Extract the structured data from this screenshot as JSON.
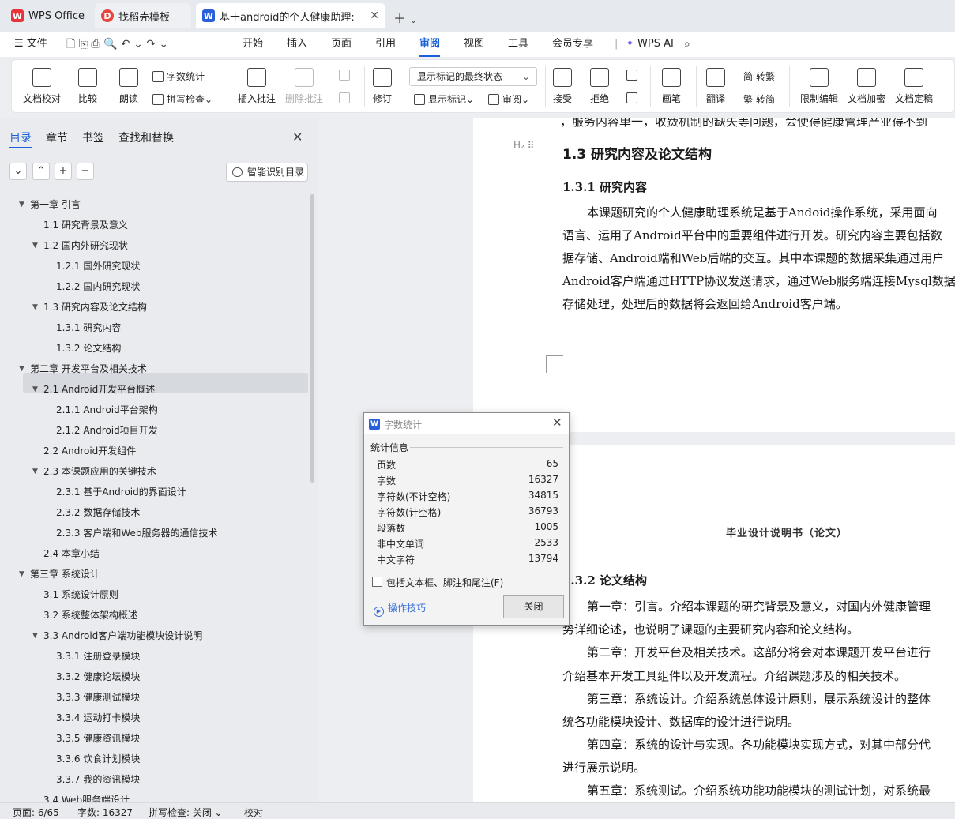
{
  "tabs": [
    {
      "label": "WPS Office",
      "icon": "wps-logo-icon"
    },
    {
      "label": "找稻壳模板",
      "icon": "docer-icon"
    },
    {
      "label": "基于android的个人健康助理:",
      "icon": "word-doc-icon"
    }
  ],
  "menu": {
    "file": "文件",
    "items": [
      "开始",
      "插入",
      "页面",
      "引用",
      "审阅",
      "视图",
      "工具",
      "会员专享"
    ],
    "active": "审阅",
    "ai": "WPS AI"
  },
  "ribbon": {
    "doc_check": "文档校对",
    "compare": "比较",
    "read_aloud": "朗读",
    "word_count": "字数统计",
    "spell_check": "拼写检查",
    "insert_comment": "插入批注",
    "delete_comment": "删除批注",
    "revise": "修订",
    "show_mode": "显示标记的最终状态",
    "show_marks": "显示标记",
    "review_pane": "审阅",
    "accept": "接受",
    "reject": "拒绝",
    "draw": "画笔",
    "translate": "翻译",
    "to_traditional": "转繁",
    "to_simplified": "转简",
    "restrict_edit": "限制编辑",
    "encrypt": "文档加密",
    "finalize": "文档定稿",
    "glyph_simp": "简",
    "glyph_trad": "繁"
  },
  "side_panel": {
    "tabs": [
      "目录",
      "章节",
      "书签",
      "查找和替换"
    ],
    "active_tab": "目录",
    "smart_toc": "智能识别目录",
    "toc": [
      {
        "label": "第一章  引言",
        "level": 1,
        "expanded": true
      },
      {
        "label": "1.1  研究背景及意义",
        "level": 2
      },
      {
        "label": "1.2  国内外研究现状",
        "level": 2,
        "expanded": true
      },
      {
        "label": "1.2.1  国外研究现状",
        "level": 3
      },
      {
        "label": "1.2.2  国内研究现状",
        "level": 3
      },
      {
        "label": "1.3  研究内容及论文结构",
        "level": 2,
        "expanded": true,
        "selected": true
      },
      {
        "label": "1.3.1  研究内容",
        "level": 3
      },
      {
        "label": "1.3.2  论文结构",
        "level": 3
      },
      {
        "label": "第二章  开发平台及相关技术",
        "level": 1,
        "expanded": true
      },
      {
        "label": "2.1 Android开发平台概述",
        "level": 2,
        "expanded": true
      },
      {
        "label": "2.1.1 Android平台架构",
        "level": 3
      },
      {
        "label": "2.1.2 Android项目开发",
        "level": 3
      },
      {
        "label": "2.2 Android开发组件",
        "level": 2
      },
      {
        "label": "2.3  本课题应用的关键技术",
        "level": 2,
        "expanded": true
      },
      {
        "label": "2.3.1  基于Android的界面设计",
        "level": 3
      },
      {
        "label": "2.3.2  数据存储技术",
        "level": 3
      },
      {
        "label": "2.3.3  客户端和Web服务器的通信技术",
        "level": 3
      },
      {
        "label": "2.4  本章小结",
        "level": 2
      },
      {
        "label": "第三章  系统设计",
        "level": 1,
        "expanded": true
      },
      {
        "label": "3.1  系统设计原则",
        "level": 2
      },
      {
        "label": "3.2  系统整体架构概述",
        "level": 2
      },
      {
        "label": "3.3 Android客户端功能模块设计说明",
        "level": 2,
        "expanded": true
      },
      {
        "label": "3.3.1  注册登录模块",
        "level": 3
      },
      {
        "label": "3.3.2  健康论坛模块",
        "level": 3
      },
      {
        "label": "3.3.3  健康测试模块",
        "level": 3
      },
      {
        "label": "3.3.4  运动打卡模块",
        "level": 3
      },
      {
        "label": "3.3.5  健康资讯模块",
        "level": 3
      },
      {
        "label": "3.3.6  饮食计划模块",
        "level": 3
      },
      {
        "label": "3.3.7  我的资讯模块",
        "level": 3
      },
      {
        "label": "3.4 Web服务端设计",
        "level": 2
      }
    ]
  },
  "document": {
    "top_cut_line": "，服务内容单一，收费机制的缺失等问题，会使得健康管理产业得不到",
    "h2_marker": "H₂",
    "heading_13": "1.3  研究内容及论文结构",
    "heading_131": "1.3.1  研究内容",
    "para_131": [
      "本课题研究的个人健康助理系统是基于Andoid操作系统，采用面向",
      "语言、运用了Android平台中的重要组件进行开发。研究内容主要包括数",
      "据存储、Android端和Web后端的交互。其中本课题的数据采集通过用户",
      "Android客户端通过HTTP协议发送请求，通过Web服务端连接Mysql数据",
      "存储处理，处理后的数据将会返回给Android客户端。"
    ],
    "page_header": "毕业设计说明书（论文）",
    "heading_132": "1.3.2  论文结构",
    "para_132": [
      "第一章：引言。介绍本课题的研究背景及意义，对国内外健康管理",
      "势详细论述，也说明了课题的主要研究内容和论文结构。",
      "第二章：开发平台及相关技术。这部分将会对本课题开发平台进行",
      "介绍基本开发工具组件以及开发流程。介绍课题涉及的相关技术。",
      "第三章：系统设计。介绍系统总体设计原则，展示系统设计的整体",
      "统各功能模块设计、数据库的设计进行说明。",
      "第四章：系统的设计与实现。各功能模块实现方式，对其中部分代",
      "进行展示说明。",
      "第五章：系统测试。介绍系统功能功能模块的测试计划，对系统最"
    ]
  },
  "dialog": {
    "title": "字数统计",
    "section": "统计信息",
    "stats": [
      {
        "label": "页数",
        "value": "65"
      },
      {
        "label": "字数",
        "value": "16327"
      },
      {
        "label": "字符数(不计空格)",
        "value": "34815"
      },
      {
        "label": "字符数(计空格)",
        "value": "36793"
      },
      {
        "label": "段落数",
        "value": "1005"
      },
      {
        "label": "非中文单词",
        "value": "2533"
      },
      {
        "label": "中文字符",
        "value": "13794"
      }
    ],
    "include_label": "包括文本框、脚注和尾注(F)",
    "include_checked": false,
    "tips": "操作技巧",
    "close": "关闭"
  },
  "status": {
    "page": "页面: 6/65",
    "words": "字数: 16327",
    "spell": "拼写检查: 关闭",
    "proof": "校对"
  },
  "colors": {
    "accent": "#1b5fd9",
    "wps_red": "#e8333a",
    "docer_red": "#e5463f",
    "word_blue": "#2b5fd9"
  }
}
